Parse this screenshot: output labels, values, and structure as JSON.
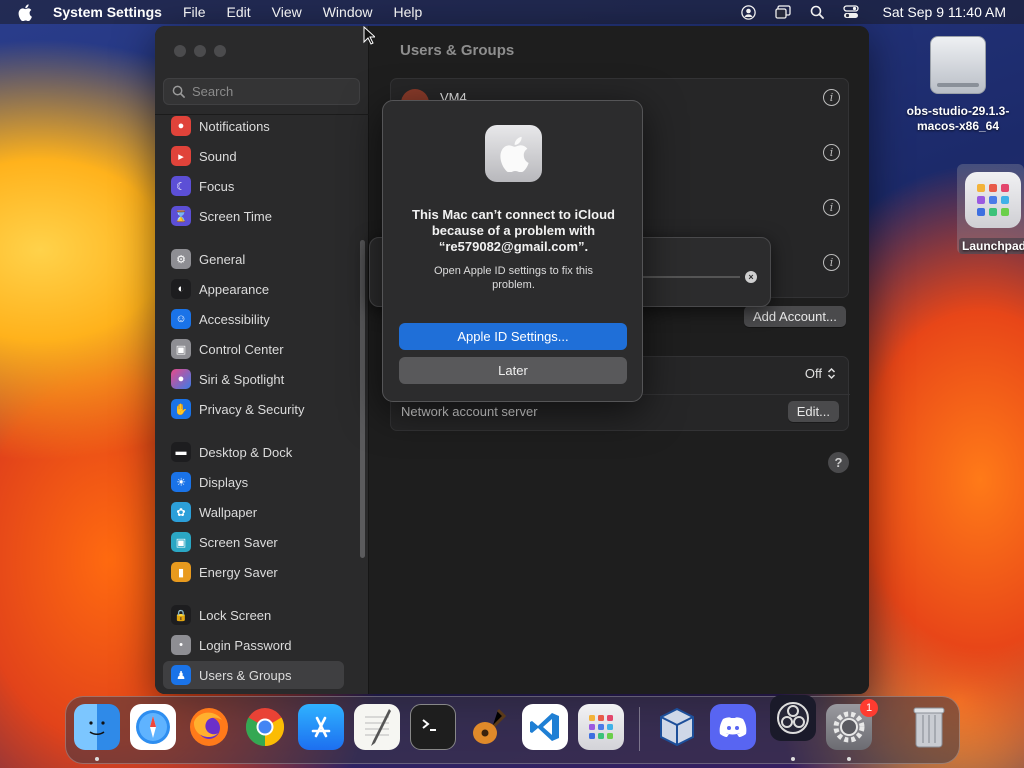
{
  "menubar": {
    "app_name": "System Settings",
    "menus": [
      "File",
      "Edit",
      "View",
      "Window",
      "Help"
    ],
    "clock": "Sat Sep 9  11:40 AM",
    "status_icons": [
      "user-icon",
      "screen-mirroring-icon",
      "search-icon",
      "control-center-icon"
    ]
  },
  "sidebar": {
    "search_placeholder": "Search",
    "items": [
      {
        "label": "Notifications",
        "icon": "bell-icon",
        "color": "#e0433a"
      },
      {
        "label": "Sound",
        "icon": "speaker-icon",
        "color": "#e0433a"
      },
      {
        "label": "Focus",
        "icon": "moon-icon",
        "color": "#5c4fd6"
      },
      {
        "label": "Screen Time",
        "icon": "hourglass-icon",
        "color": "#5c4fd6"
      },
      {
        "label": "General",
        "icon": "gear-icon",
        "color": "#8e8e93"
      },
      {
        "label": "Appearance",
        "icon": "appearance-icon",
        "color": "#1d1d1f"
      },
      {
        "label": "Accessibility",
        "icon": "accessibility-icon",
        "color": "#1a73e8"
      },
      {
        "label": "Control Center",
        "icon": "toggles-icon",
        "color": "#8e8e93"
      },
      {
        "label": "Siri & Spotlight",
        "icon": "siri-icon",
        "color": "#7a3fd1"
      },
      {
        "label": "Privacy & Security",
        "icon": "hand-icon",
        "color": "#1a73e8"
      },
      {
        "label": "Desktop & Dock",
        "icon": "dock-icon",
        "color": "#1d1d1f"
      },
      {
        "label": "Displays",
        "icon": "sun-icon",
        "color": "#1a73e8"
      },
      {
        "label": "Wallpaper",
        "icon": "wallpaper-icon",
        "color": "#2c9fd9"
      },
      {
        "label": "Screen Saver",
        "icon": "screensaver-icon",
        "color": "#2ba7c4"
      },
      {
        "label": "Energy Saver",
        "icon": "battery-icon",
        "color": "#e89a1e"
      },
      {
        "label": "Lock Screen",
        "icon": "lock-icon",
        "color": "#1d1d1f"
      },
      {
        "label": "Login Password",
        "icon": "password-icon",
        "color": "#8e8e93"
      },
      {
        "label": "Users & Groups",
        "icon": "users-icon",
        "color": "#1a73e8"
      }
    ]
  },
  "main": {
    "title": "Users & Groups",
    "first_user": "VM4",
    "add_account": "Add Account...",
    "auto_login_value": "Off",
    "network_account_server": "Network account server",
    "edit": "Edit...",
    "help": "?"
  },
  "alert": {
    "title": "This Mac can’t connect to iCloud because of a problem with “re579082@gmail.com”.",
    "message": "Open Apple ID settings to fix this problem.",
    "primary_button": "Apple ID Settings...",
    "secondary_button": "Later"
  },
  "desktop": {
    "dmg_label": "obs-studio-29.1.3-macos-x86_64",
    "launchpad_label": "Launchpad"
  },
  "dock": {
    "apps": [
      "Finder",
      "Safari",
      "Firefox",
      "Chrome",
      "App Store",
      "TextEdit",
      "Terminal",
      "GarageBand",
      "Visual Studio Code",
      "Launchpad",
      "VirtualBox",
      "Discord",
      "OBS",
      "System Settings",
      "Trash"
    ],
    "system_settings_badge": "1"
  },
  "colors": {
    "accent": "#1f6fd8",
    "window_bg": "#1e1e1e",
    "sidebar_bg": "#2a2a2b"
  }
}
